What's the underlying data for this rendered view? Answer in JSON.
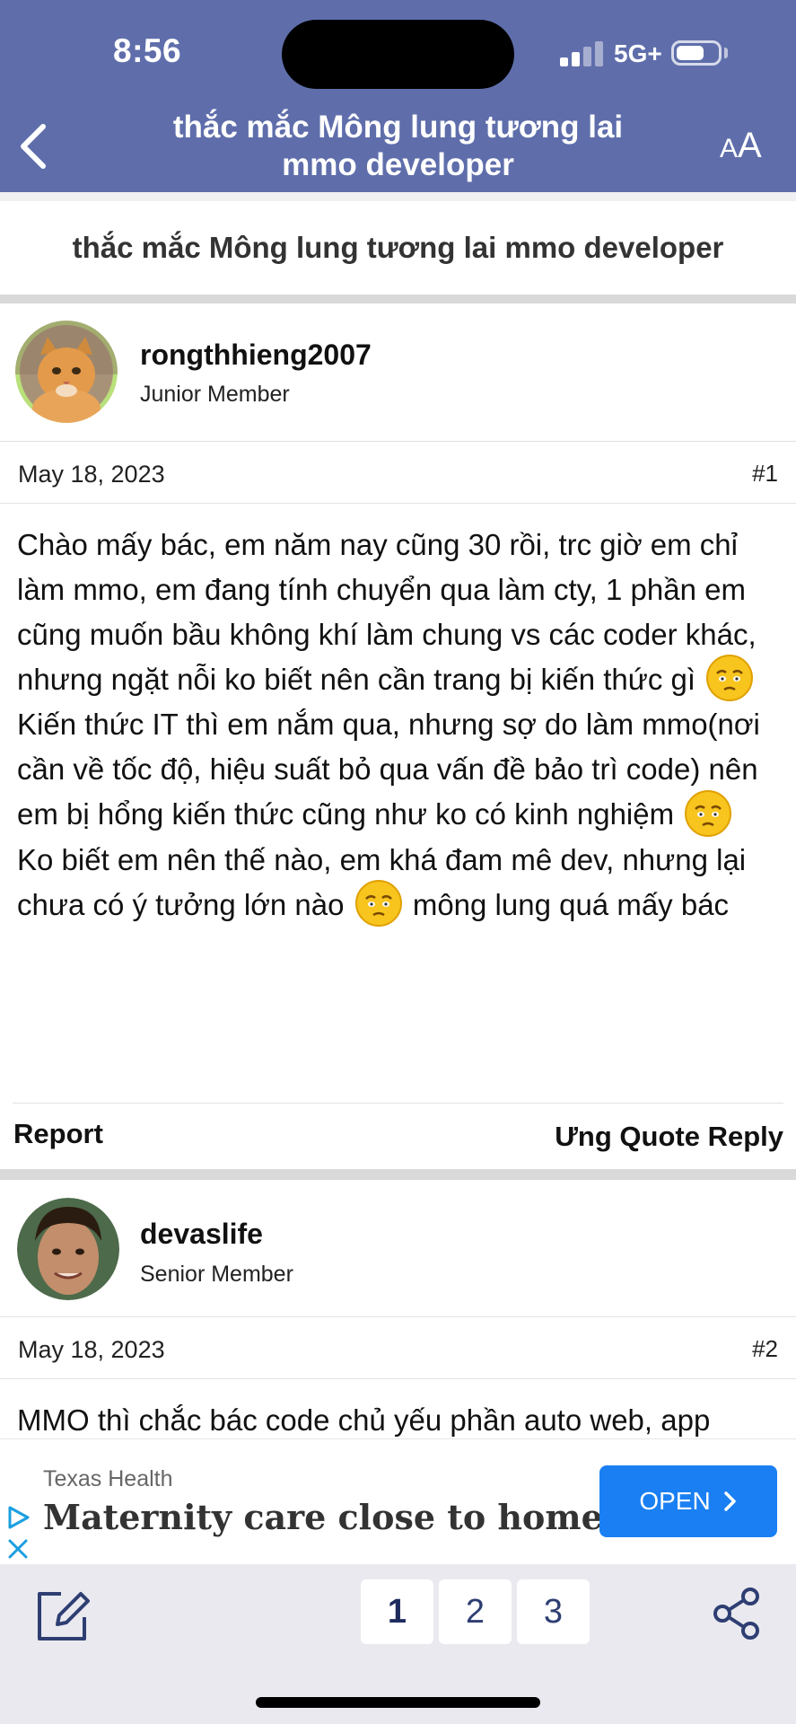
{
  "status_bar": {
    "time": "8:56",
    "network": "5G+"
  },
  "header": {
    "title": "thắc mắc Mông lung tương lai mmo developer",
    "font_button": {
      "small": "A",
      "big": "A"
    }
  },
  "thread_title": "thắc mắc Mông lung tương lai mmo developer",
  "posts": [
    {
      "username": "rongthhieng2007",
      "role": "Junior Member",
      "date": "May 18, 2023",
      "number": "#1",
      "paragraphs": [
        {
          "text": "Chào mấy bác, em năm nay cũng 30 rồi, trc giờ em chỉ làm mmo, em đang tính chuyển qua làm cty, 1 phần em cũng muốn bầu không khí làm chung vs các coder khác, nhưng ngặt nỗi ko biết nên cần trang bị kiến thức gì",
          "after": ""
        },
        {
          "text": "Kiến thức IT thì em nắm qua, nhưng sợ do làm mmo(nơi cần về tốc độ, hiệu suất bỏ qua vấn đề bảo trì code) nên em bị hổng kiến thức cũng như ko có kinh nghiệm",
          "after": ""
        },
        {
          "text": "Ko biết em nên thế nào, em khá đam mê dev, nhưng lại chưa có ý tưởng lớn nào",
          "after": " mông lung quá mấy bác"
        }
      ],
      "actions": {
        "report": "Report",
        "right": "Ưng Quote Reply"
      }
    },
    {
      "username": "devaslife",
      "role": "Senior Member",
      "date": "May 18, 2023",
      "number": "#2",
      "text": "MMO thì chắc bác code chủ yếu phần auto web, app"
    }
  ],
  "ad": {
    "sponsor": "Texas Health",
    "headline": "Maternity care close to home",
    "button": "OPEN"
  },
  "pagination": {
    "pages": [
      "1",
      "2",
      "3"
    ],
    "current": "1"
  },
  "icons": [
    "back-chevron-icon",
    "emoji-worried-icon",
    "ad-choices-icon",
    "close-icon",
    "compose-icon",
    "share-icon"
  ],
  "colors": {
    "header": "#5f6eab",
    "ad_button": "#1a7ff2",
    "bottom_bar": "#e9e9ef",
    "page_text": "#2e3e72"
  }
}
